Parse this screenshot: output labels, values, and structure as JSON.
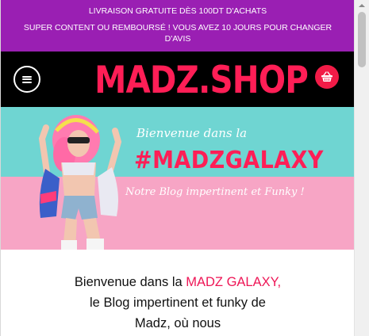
{
  "promo": {
    "line1": "LIVRAISON GRATUITE DÈS 100DT D'ACHATS",
    "line2": "SUPER CONTENT OU REMBOURSÉ ! VOUS AVEZ 10 JOURS POUR CHANGER D'AVIS"
  },
  "header": {
    "logo_text": "MADZ.SHOP",
    "menu_icon": "hamburger-menu-icon",
    "cart_icon": "basket-icon"
  },
  "hero": {
    "welcome": "Bienvenue dans la",
    "hashtag": "#MADZGALAXY",
    "tagline": "Notre Blog impertinent et Funky !"
  },
  "article": {
    "intro_before": "Bienvenue dans la ",
    "intro_highlight": "MADZ GALAXY,",
    "intro_after": " le Blog impertinent et funky de Madz, où nous"
  },
  "colors": {
    "promo_bg": "#9a1fb3",
    "brand_pink": "#ff1e56",
    "header_bg": "#000000",
    "hero_teal": "#6fd5d2",
    "hero_pink": "#f7a5c5"
  }
}
